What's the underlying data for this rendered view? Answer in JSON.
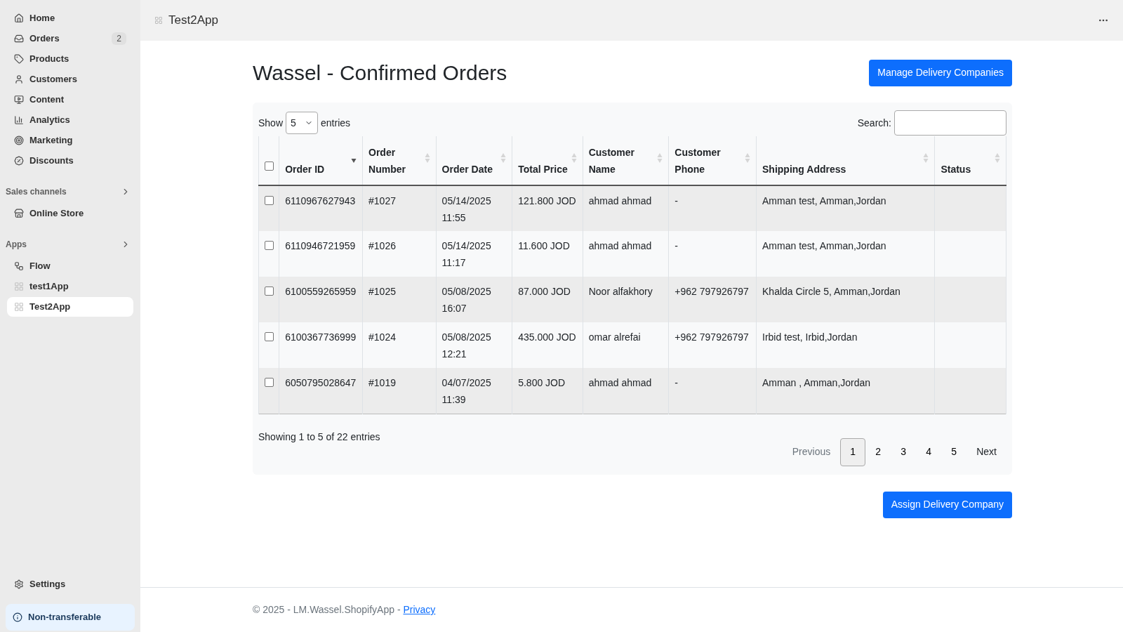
{
  "sidebar": {
    "items": [
      {
        "label": "Home",
        "selected": false
      },
      {
        "label": "Orders",
        "badge": "2",
        "selected": false
      },
      {
        "label": "Products",
        "selected": false
      },
      {
        "label": "Customers",
        "selected": false
      },
      {
        "label": "Content",
        "selected": false
      },
      {
        "label": "Analytics",
        "selected": false
      },
      {
        "label": "Marketing",
        "selected": false
      },
      {
        "label": "Discounts",
        "selected": false
      }
    ],
    "sections": [
      {
        "title": "Sales channels",
        "items": [
          {
            "label": "Online Store",
            "selected": false
          }
        ]
      },
      {
        "title": "Apps",
        "items": [
          {
            "label": "Flow",
            "selected": false
          },
          {
            "label": "test1App",
            "selected": false
          },
          {
            "label": "Test2App",
            "selected": true
          }
        ]
      }
    ],
    "settings": "Settings",
    "notice": "Non-transferable"
  },
  "top_bar": {
    "title": "Test2App"
  },
  "page": {
    "title": "Wassel - Confirmed Orders",
    "manage_button": "Manage Delivery Companies",
    "show_label": "Show",
    "page_size": "5",
    "entries_label": "entries",
    "search_label": "Search:",
    "table": {
      "select_all_checked": false,
      "columns": [
        {
          "label": "Order ID",
          "sorted": true
        },
        {
          "label": "Order Number",
          "sorted": false
        },
        {
          "label": "Order Date",
          "sorted": false
        },
        {
          "label": "Total Price",
          "sorted": false
        },
        {
          "label": "Customer Name",
          "sorted": false
        },
        {
          "label": "Customer Phone",
          "sorted": false
        },
        {
          "label": "Shipping Address",
          "sorted": false
        },
        {
          "label": "Status",
          "sorted": false
        }
      ],
      "rows": [
        {
          "checked": false,
          "cells": [
            "6110967627943",
            "#1027",
            "05/14/2025 11:55",
            "121.800 JOD",
            "ahmad ahmad",
            "-",
            "Amman test, Amman,Jordan",
            ""
          ]
        },
        {
          "checked": false,
          "cells": [
            "6110946721959",
            "#1026",
            "05/14/2025 11:17",
            "11.600 JOD",
            "ahmad ahmad",
            "-",
            "Amman test, Amman,Jordan",
            ""
          ]
        },
        {
          "checked": false,
          "cells": [
            "6100559265959",
            "#1025",
            "05/08/2025 16:07",
            "87.000 JOD",
            "Noor alfakhory",
            "+962 797926797",
            "Khalda Circle 5, Amman,Jordan",
            ""
          ]
        },
        {
          "checked": false,
          "cells": [
            "6100367736999",
            "#1024",
            "05/08/2025 12:21",
            "435.000 JOD",
            "omar alrefai",
            "+962 797926797",
            "Irbid test, Irbid,Jordan",
            ""
          ]
        },
        {
          "checked": false,
          "cells": [
            "6050795028647",
            "#1019",
            "04/07/2025 11:39",
            "5.800 JOD",
            "ahmad ahmad",
            "-",
            "Amman , Amman,Jordan",
            ""
          ]
        }
      ]
    },
    "info": "Showing 1 to 5 of 22 entries",
    "pagination": {
      "previous": {
        "label": "Previous",
        "disabled": true
      },
      "pages": [
        {
          "label": "1",
          "selected": true
        },
        {
          "label": "2",
          "selected": false
        },
        {
          "label": "3",
          "selected": false
        },
        {
          "label": "4",
          "selected": false
        },
        {
          "label": "5",
          "selected": false
        }
      ],
      "next": {
        "label": "Next",
        "disabled": false
      }
    },
    "assign_button": "Assign Delivery Company"
  },
  "footer": {
    "text": "© 2025 - LM.Wassel.ShopifyApp - ",
    "link": "Privacy"
  }
}
